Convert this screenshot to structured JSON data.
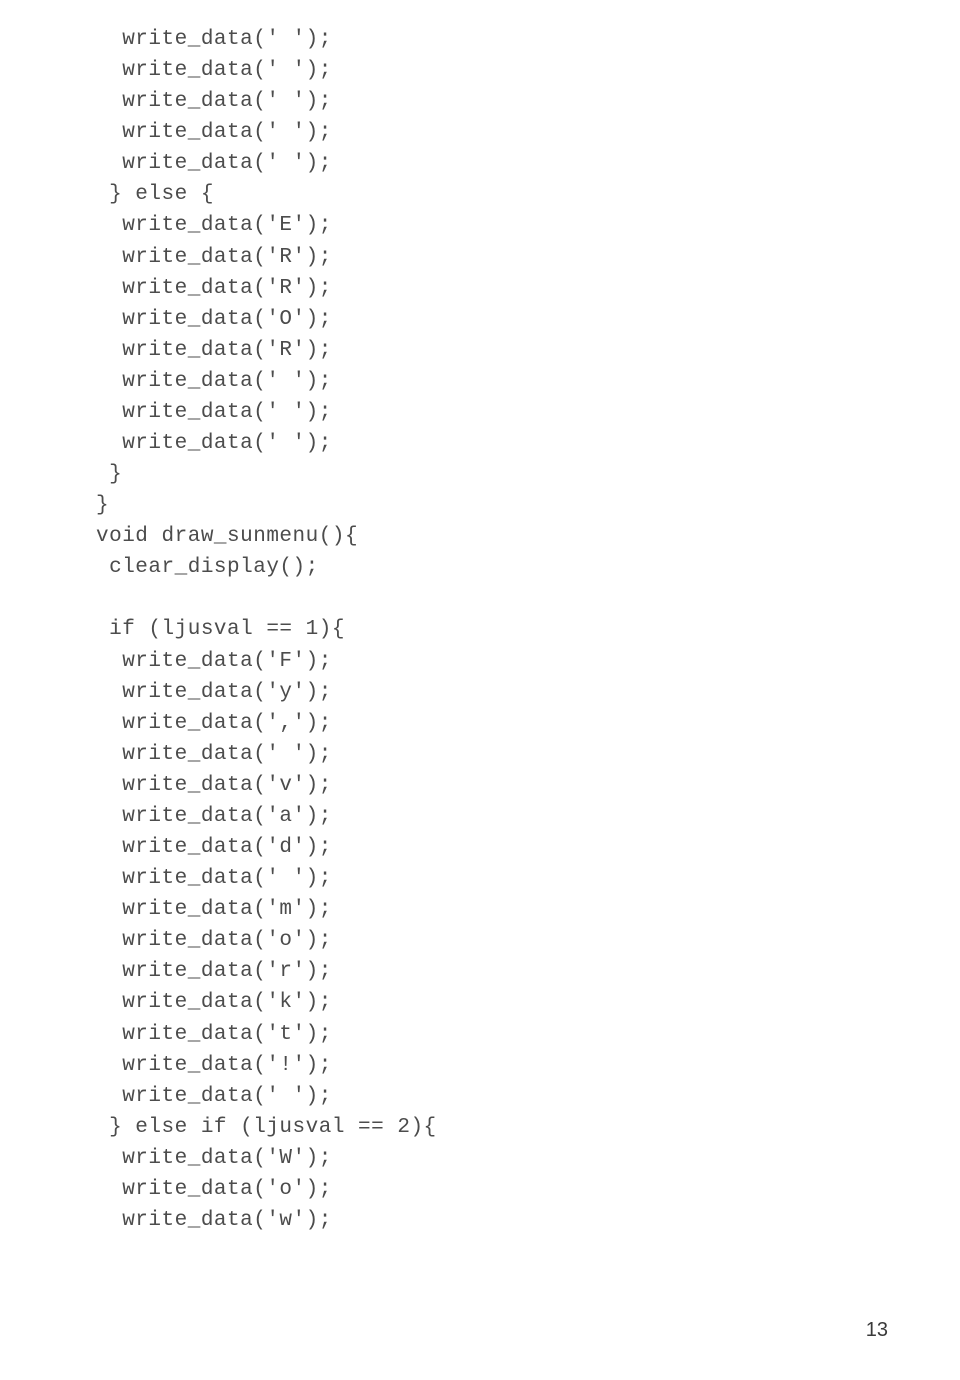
{
  "page_number": "13",
  "code_lines": [
    "  write_data(' ');",
    "  write_data(' ');",
    "  write_data(' ');",
    "  write_data(' ');",
    "  write_data(' ');",
    " } else {",
    "  write_data('E');",
    "  write_data('R');",
    "  write_data('R');",
    "  write_data('O');",
    "  write_data('R');",
    "  write_data(' ');",
    "  write_data(' ');",
    "  write_data(' ');",
    " }",
    "}",
    "void draw_sunmenu(){",
    " clear_display();",
    "",
    " if (ljusval == 1){",
    "  write_data('F');",
    "  write_data('y');",
    "  write_data(',');",
    "  write_data(' ');",
    "  write_data('v');",
    "  write_data('a');",
    "  write_data('d');",
    "  write_data(' ');",
    "  write_data('m');",
    "  write_data('o');",
    "  write_data('r');",
    "  write_data('k');",
    "  write_data('t');",
    "  write_data('!');",
    "  write_data(' ');",
    " } else if (ljusval == 2){",
    "  write_data('W');",
    "  write_data('o');",
    "  write_data('w');"
  ]
}
